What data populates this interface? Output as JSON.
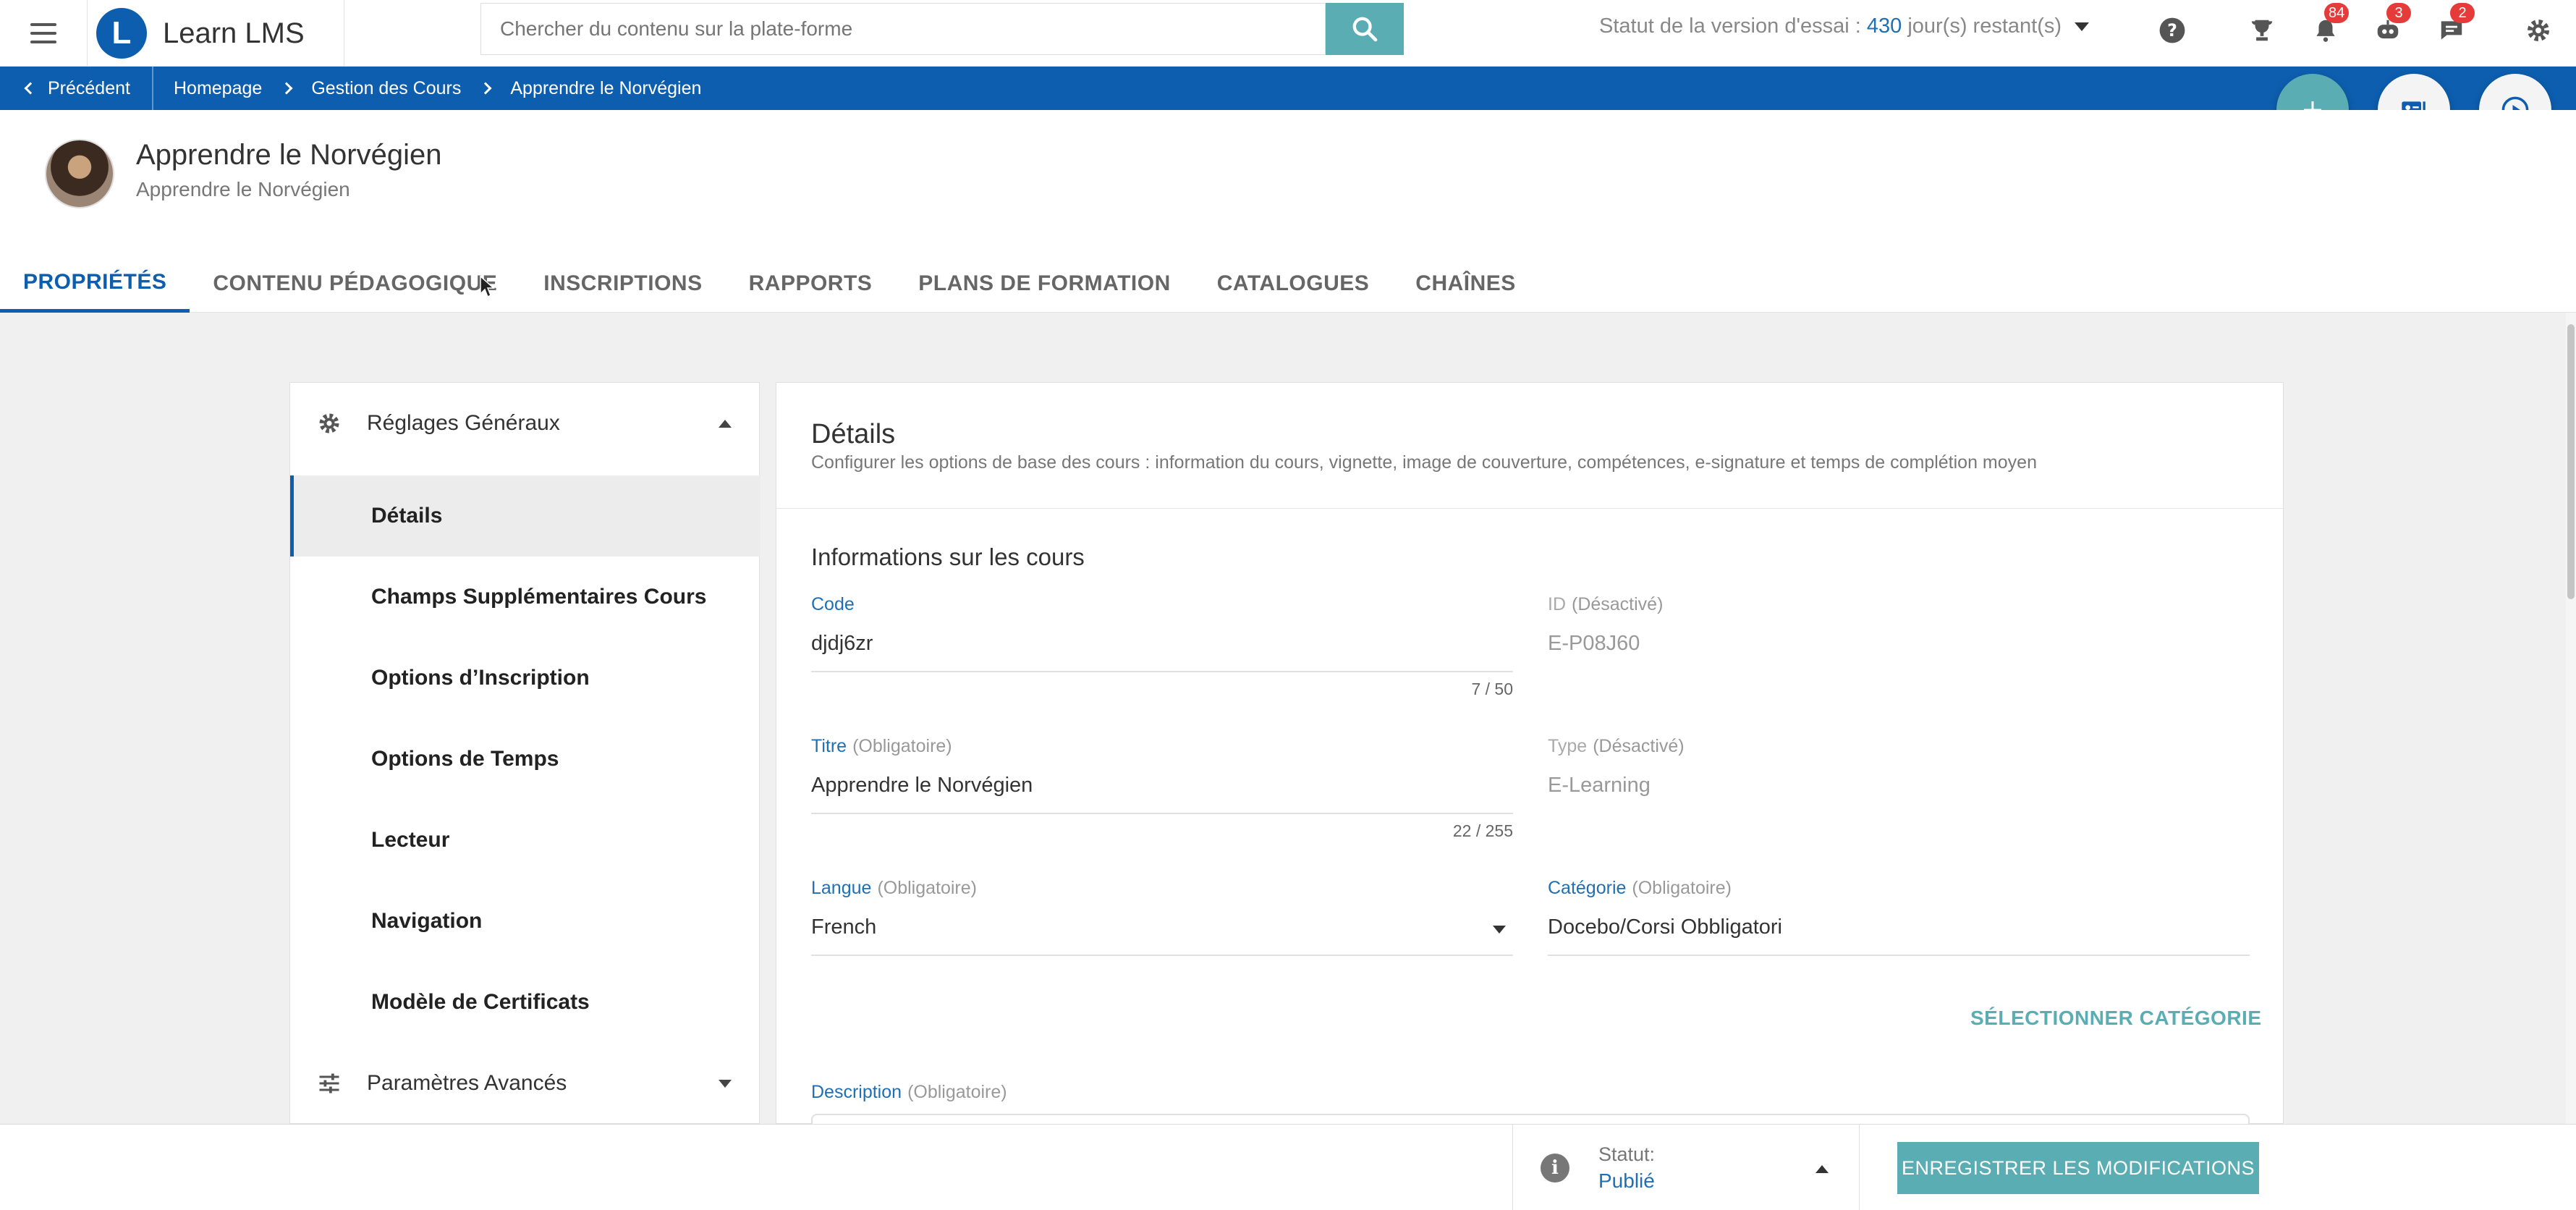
{
  "app": {
    "name": "Learn LMS"
  },
  "search": {
    "placeholder": "Chercher du contenu sur la plate-forme"
  },
  "trial": {
    "prefix": "Statut de la version d'essai :",
    "days": "430",
    "suffix": "jour(s) restant(s)"
  },
  "notifications": {
    "bell": "84",
    "robot": "3",
    "chat": "2"
  },
  "breadcrumb": {
    "back": "Précédent",
    "items": [
      "Homepage",
      "Gestion des Cours",
      "Apprendre le Norvégien"
    ]
  },
  "course": {
    "title": "Apprendre le Norvégien",
    "subtitle": "Apprendre le Norvégien"
  },
  "tabs": [
    "PROPRIÉTÉS",
    "CONTENU PÉDAGOGIQUE",
    "INSCRIPTIONS",
    "RAPPORTS",
    "PLANS DE FORMATION",
    "CATALOGUES",
    "CHAÎNES"
  ],
  "sidebar": {
    "general": "Réglages Généraux",
    "items": [
      "Détails",
      "Champs Supplémentaires Cours",
      "Options d’Inscription",
      "Options de Temps",
      "Lecteur",
      "Navigation",
      "Modèle de Certificats"
    ],
    "advanced": "Paramètres Avancés"
  },
  "main": {
    "title": "Détails",
    "description": "Configurer les options de base des cours : information du cours, vignette, image de couverture, compétences, e-signature et temps de complétion moyen",
    "section": "Informations sur les cours",
    "code": {
      "label": "Code",
      "value": "djdj6zr",
      "counter": "7 / 50"
    },
    "id": {
      "label": "ID",
      "note": "(Désactivé)",
      "value": "E-P08J60"
    },
    "titre": {
      "label": "Titre",
      "note": "(Obligatoire)",
      "value": "Apprendre le Norvégien",
      "counter": "22 / 255"
    },
    "type": {
      "label": "Type",
      "note": "(Désactivé)",
      "value": "E-Learning"
    },
    "langue": {
      "label": "Langue",
      "note": "(Obligatoire)",
      "value": "French"
    },
    "categorie": {
      "label": "Catégorie",
      "note": "(Obligatoire)",
      "value": "Docebo/Corsi Obbligatori"
    },
    "select_category": "SÉLECTIONNER CATÉGORIE",
    "description_field": {
      "label": "Description",
      "note": "(Obligatoire)"
    }
  },
  "footer": {
    "status_label": "Statut:",
    "status_value": "Publié",
    "save": "ENREGISTRER LES MODIFICATIONS"
  },
  "colors": {
    "primary": "#0d5eaf",
    "teal": "#5aaeb3",
    "badge": "#e53b3b"
  }
}
